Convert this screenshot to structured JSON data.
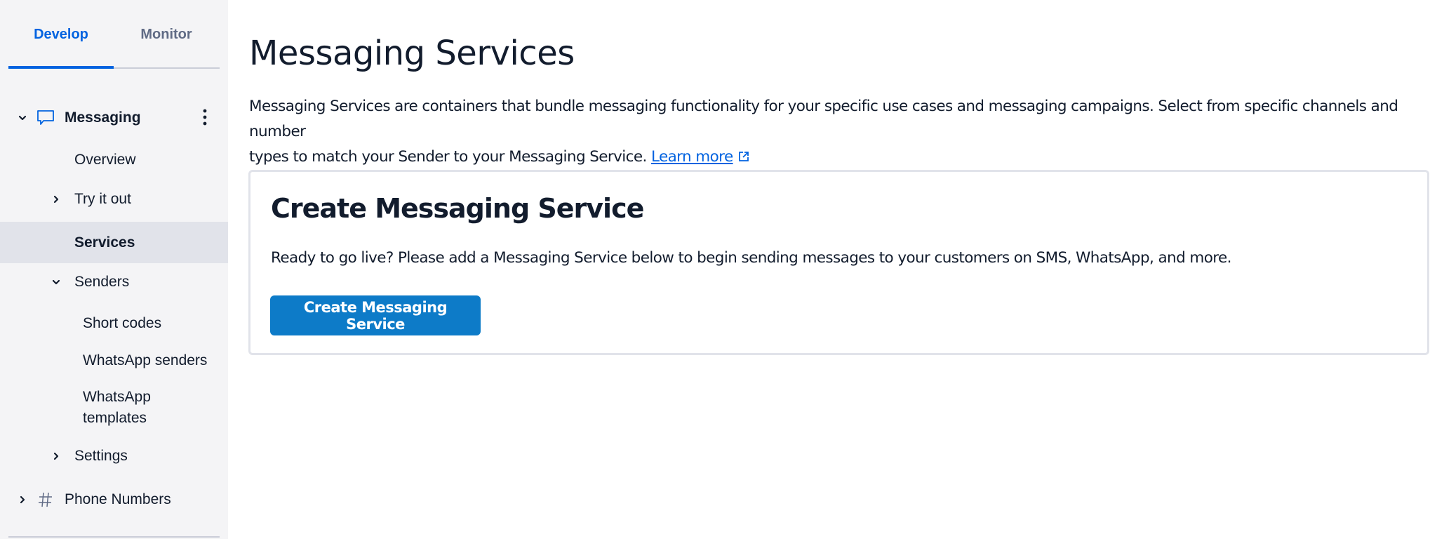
{
  "sidebar": {
    "tabs": [
      {
        "label": "Develop",
        "active": true
      },
      {
        "label": "Monitor",
        "active": false
      }
    ],
    "sections": {
      "messaging": {
        "label": "Messaging",
        "icon": "chat-bubble-icon",
        "expanded": true,
        "items": {
          "overview": "Overview",
          "try_it_out": "Try it out",
          "services": "Services",
          "senders": "Senders",
          "short_codes": "Short codes",
          "whatsapp_senders": "WhatsApp senders",
          "whatsapp_templates_line1": "WhatsApp",
          "whatsapp_templates_line2": "templates",
          "settings": "Settings"
        },
        "selected": "Services"
      },
      "phone_numbers": {
        "label": "Phone Numbers",
        "icon": "hash-icon",
        "expanded": false
      }
    }
  },
  "main": {
    "title": "Messaging Services",
    "description_line1": "Messaging Services are containers that bundle messaging functionality for your specific use cases and messaging campaigns. Select from specific channels and number",
    "description_line2": "types to match your Sender to your Messaging Service.",
    "learn_more": "Learn more",
    "card": {
      "title": "Create Messaging Service",
      "text": "Ready to go live? Please add a Messaging Service below to begin sending messages to your customers on SMS, WhatsApp, and more.",
      "button_label": "Create Messaging Service"
    }
  },
  "colors": {
    "accent": "#0263e0",
    "button": "#0d7bc8",
    "sidebar_bg": "#f4f4f6",
    "selected_bg": "#e1e3ea",
    "text": "#121c2d"
  }
}
